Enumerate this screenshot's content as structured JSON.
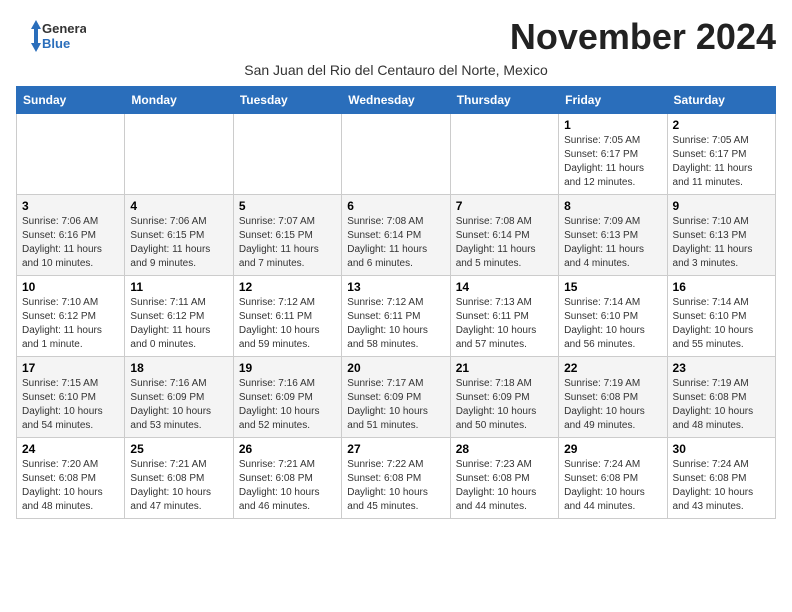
{
  "logo": {
    "general": "General",
    "blue": "Blue"
  },
  "title": "November 2024",
  "subtitle": "San Juan del Rio del Centauro del Norte, Mexico",
  "weekdays": [
    "Sunday",
    "Monday",
    "Tuesday",
    "Wednesday",
    "Thursday",
    "Friday",
    "Saturday"
  ],
  "weeks": [
    [
      {
        "day": "",
        "info": ""
      },
      {
        "day": "",
        "info": ""
      },
      {
        "day": "",
        "info": ""
      },
      {
        "day": "",
        "info": ""
      },
      {
        "day": "",
        "info": ""
      },
      {
        "day": "1",
        "info": "Sunrise: 7:05 AM\nSunset: 6:17 PM\nDaylight: 11 hours and 12 minutes."
      },
      {
        "day": "2",
        "info": "Sunrise: 7:05 AM\nSunset: 6:17 PM\nDaylight: 11 hours and 11 minutes."
      }
    ],
    [
      {
        "day": "3",
        "info": "Sunrise: 7:06 AM\nSunset: 6:16 PM\nDaylight: 11 hours and 10 minutes."
      },
      {
        "day": "4",
        "info": "Sunrise: 7:06 AM\nSunset: 6:15 PM\nDaylight: 11 hours and 9 minutes."
      },
      {
        "day": "5",
        "info": "Sunrise: 7:07 AM\nSunset: 6:15 PM\nDaylight: 11 hours and 7 minutes."
      },
      {
        "day": "6",
        "info": "Sunrise: 7:08 AM\nSunset: 6:14 PM\nDaylight: 11 hours and 6 minutes."
      },
      {
        "day": "7",
        "info": "Sunrise: 7:08 AM\nSunset: 6:14 PM\nDaylight: 11 hours and 5 minutes."
      },
      {
        "day": "8",
        "info": "Sunrise: 7:09 AM\nSunset: 6:13 PM\nDaylight: 11 hours and 4 minutes."
      },
      {
        "day": "9",
        "info": "Sunrise: 7:10 AM\nSunset: 6:13 PM\nDaylight: 11 hours and 3 minutes."
      }
    ],
    [
      {
        "day": "10",
        "info": "Sunrise: 7:10 AM\nSunset: 6:12 PM\nDaylight: 11 hours and 1 minute."
      },
      {
        "day": "11",
        "info": "Sunrise: 7:11 AM\nSunset: 6:12 PM\nDaylight: 11 hours and 0 minutes."
      },
      {
        "day": "12",
        "info": "Sunrise: 7:12 AM\nSunset: 6:11 PM\nDaylight: 10 hours and 59 minutes."
      },
      {
        "day": "13",
        "info": "Sunrise: 7:12 AM\nSunset: 6:11 PM\nDaylight: 10 hours and 58 minutes."
      },
      {
        "day": "14",
        "info": "Sunrise: 7:13 AM\nSunset: 6:11 PM\nDaylight: 10 hours and 57 minutes."
      },
      {
        "day": "15",
        "info": "Sunrise: 7:14 AM\nSunset: 6:10 PM\nDaylight: 10 hours and 56 minutes."
      },
      {
        "day": "16",
        "info": "Sunrise: 7:14 AM\nSunset: 6:10 PM\nDaylight: 10 hours and 55 minutes."
      }
    ],
    [
      {
        "day": "17",
        "info": "Sunrise: 7:15 AM\nSunset: 6:10 PM\nDaylight: 10 hours and 54 minutes."
      },
      {
        "day": "18",
        "info": "Sunrise: 7:16 AM\nSunset: 6:09 PM\nDaylight: 10 hours and 53 minutes."
      },
      {
        "day": "19",
        "info": "Sunrise: 7:16 AM\nSunset: 6:09 PM\nDaylight: 10 hours and 52 minutes."
      },
      {
        "day": "20",
        "info": "Sunrise: 7:17 AM\nSunset: 6:09 PM\nDaylight: 10 hours and 51 minutes."
      },
      {
        "day": "21",
        "info": "Sunrise: 7:18 AM\nSunset: 6:09 PM\nDaylight: 10 hours and 50 minutes."
      },
      {
        "day": "22",
        "info": "Sunrise: 7:19 AM\nSunset: 6:08 PM\nDaylight: 10 hours and 49 minutes."
      },
      {
        "day": "23",
        "info": "Sunrise: 7:19 AM\nSunset: 6:08 PM\nDaylight: 10 hours and 48 minutes."
      }
    ],
    [
      {
        "day": "24",
        "info": "Sunrise: 7:20 AM\nSunset: 6:08 PM\nDaylight: 10 hours and 48 minutes."
      },
      {
        "day": "25",
        "info": "Sunrise: 7:21 AM\nSunset: 6:08 PM\nDaylight: 10 hours and 47 minutes."
      },
      {
        "day": "26",
        "info": "Sunrise: 7:21 AM\nSunset: 6:08 PM\nDaylight: 10 hours and 46 minutes."
      },
      {
        "day": "27",
        "info": "Sunrise: 7:22 AM\nSunset: 6:08 PM\nDaylight: 10 hours and 45 minutes."
      },
      {
        "day": "28",
        "info": "Sunrise: 7:23 AM\nSunset: 6:08 PM\nDaylight: 10 hours and 44 minutes."
      },
      {
        "day": "29",
        "info": "Sunrise: 7:24 AM\nSunset: 6:08 PM\nDaylight: 10 hours and 44 minutes."
      },
      {
        "day": "30",
        "info": "Sunrise: 7:24 AM\nSunset: 6:08 PM\nDaylight: 10 hours and 43 minutes."
      }
    ]
  ]
}
